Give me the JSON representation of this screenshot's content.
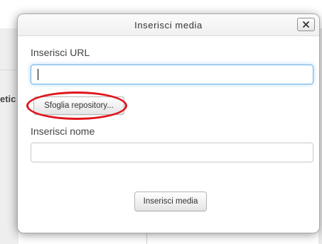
{
  "background": {
    "title_fragment": "",
    "side_fragment": "etic"
  },
  "dialog": {
    "title": "Inserisci media",
    "url_label": "Inserisci URL",
    "url_value": "",
    "browse_button": "Sfoglia repository...",
    "name_label": "Inserisci nome",
    "name_value": "",
    "submit_button": "Inserisci media"
  },
  "annotation": {
    "highlight_color": "#e0141b"
  },
  "colors": {
    "focus_border": "#6fb3e6",
    "dialog_border": "#a9a9a9"
  }
}
